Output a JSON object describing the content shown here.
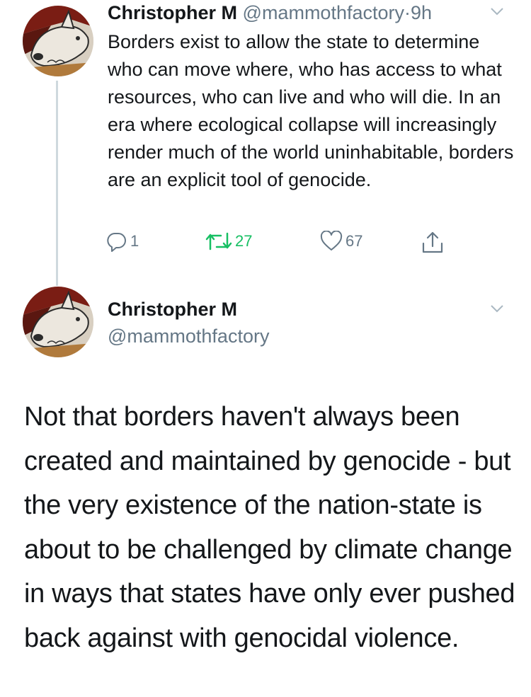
{
  "tweet1": {
    "name": "Christopher M",
    "handle": "@mammothfactory",
    "separator": "·",
    "time": "9h",
    "text": "Borders exist to allow the state to determine who can move where, who has access to what resources, who can live and who will die. In an era where ecological collapse will increasingly render much of the world uninhabitable, borders are an explicit tool of genocide.",
    "reply_count": "1",
    "retweet_count": "27",
    "like_count": "67",
    "avatar_icon": "wolf-illustration-avatar"
  },
  "tweet2": {
    "name": "Christopher M",
    "handle": "@mammothfactory",
    "text": "Not that borders haven't always been created and maintained by genocide - but the very existence of the nation-state is about to be challenged by climate change in ways that states have only ever pushed back against with genocidal violence.",
    "avatar_icon": "wolf-illustration-avatar"
  },
  "colors": {
    "text": "#14171a",
    "secondary": "#657786",
    "retweet_green": "#17bf63",
    "thread_line": "#cfd9de",
    "chevron": "#aab8c2"
  },
  "icons": [
    "reply-icon",
    "retweet-icon",
    "like-icon",
    "share-icon",
    "chevron-down-icon"
  ]
}
